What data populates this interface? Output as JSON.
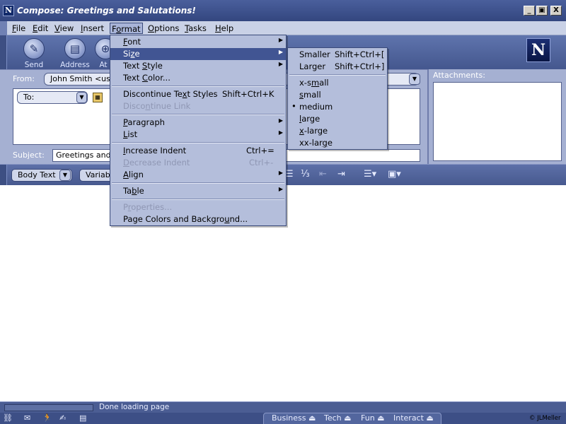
{
  "window": {
    "title": "Compose: Greetings and Salutations!",
    "app_icon": "N",
    "buttons": [
      "_",
      "▣",
      "X"
    ]
  },
  "menubar": {
    "items": [
      "File",
      "Edit",
      "View",
      "Insert",
      "Format",
      "Options",
      "Tasks",
      "Help"
    ],
    "open": "Format"
  },
  "toolbar": {
    "send": "Send",
    "address": "Address",
    "attach": "At",
    "logo": "N"
  },
  "address": {
    "from_label": "From:",
    "from_value": "John Smith <user",
    "to_label": "To:",
    "subject_label": "Subject:",
    "subject_value": "Greetings and",
    "attachments_label": "Attachments:"
  },
  "format_toolbar": {
    "body_text": "Body Text",
    "variable": "Variab"
  },
  "format_menu": {
    "items": [
      {
        "label": "Font",
        "shortcut": "",
        "submenu": true,
        "disabled": false
      },
      {
        "label": "Size",
        "shortcut": "",
        "submenu": true,
        "disabled": false,
        "highlighted": true
      },
      {
        "label": "Text Style",
        "shortcut": "",
        "submenu": true,
        "disabled": false
      },
      {
        "label": "Text Color...",
        "shortcut": "",
        "submenu": false,
        "disabled": false
      },
      {
        "label": "Discontinue Text Styles",
        "shortcut": "Shift+Ctrl+K",
        "submenu": false,
        "disabled": false
      },
      {
        "label": "Discontinue Link",
        "shortcut": "",
        "submenu": false,
        "disabled": true
      },
      {
        "label": "Paragraph",
        "shortcut": "",
        "submenu": true,
        "disabled": false
      },
      {
        "label": "List",
        "shortcut": "",
        "submenu": true,
        "disabled": false
      },
      {
        "label": "Increase Indent",
        "shortcut": "Ctrl+=",
        "submenu": false,
        "disabled": false
      },
      {
        "label": "Decrease Indent",
        "shortcut": "Ctrl+-",
        "submenu": false,
        "disabled": true
      },
      {
        "label": "Align",
        "shortcut": "",
        "submenu": true,
        "disabled": false
      },
      {
        "label": "Table",
        "shortcut": "",
        "submenu": true,
        "disabled": false
      },
      {
        "label": "Properties...",
        "shortcut": "",
        "submenu": false,
        "disabled": true
      },
      {
        "label": "Page Colors and Background...",
        "shortcut": "",
        "submenu": false,
        "disabled": false
      }
    ]
  },
  "size_menu": {
    "items": [
      {
        "label": "Smaller",
        "shortcut": "Shift+Ctrl+["
      },
      {
        "label": "Larger",
        "shortcut": "Shift+Ctrl+]"
      },
      {
        "label": "x-small",
        "checked": false
      },
      {
        "label": "small",
        "checked": false
      },
      {
        "label": "medium",
        "checked": true
      },
      {
        "label": "large",
        "checked": false
      },
      {
        "label": "x-large",
        "checked": false
      },
      {
        "label": "xx-large",
        "checked": false
      }
    ]
  },
  "status": {
    "text": "Done loading page",
    "progress": 0
  },
  "taskbar": {
    "tabs": [
      "Business",
      "Tech",
      "Fun",
      "Interact"
    ],
    "copyright": "© JLMeller"
  }
}
